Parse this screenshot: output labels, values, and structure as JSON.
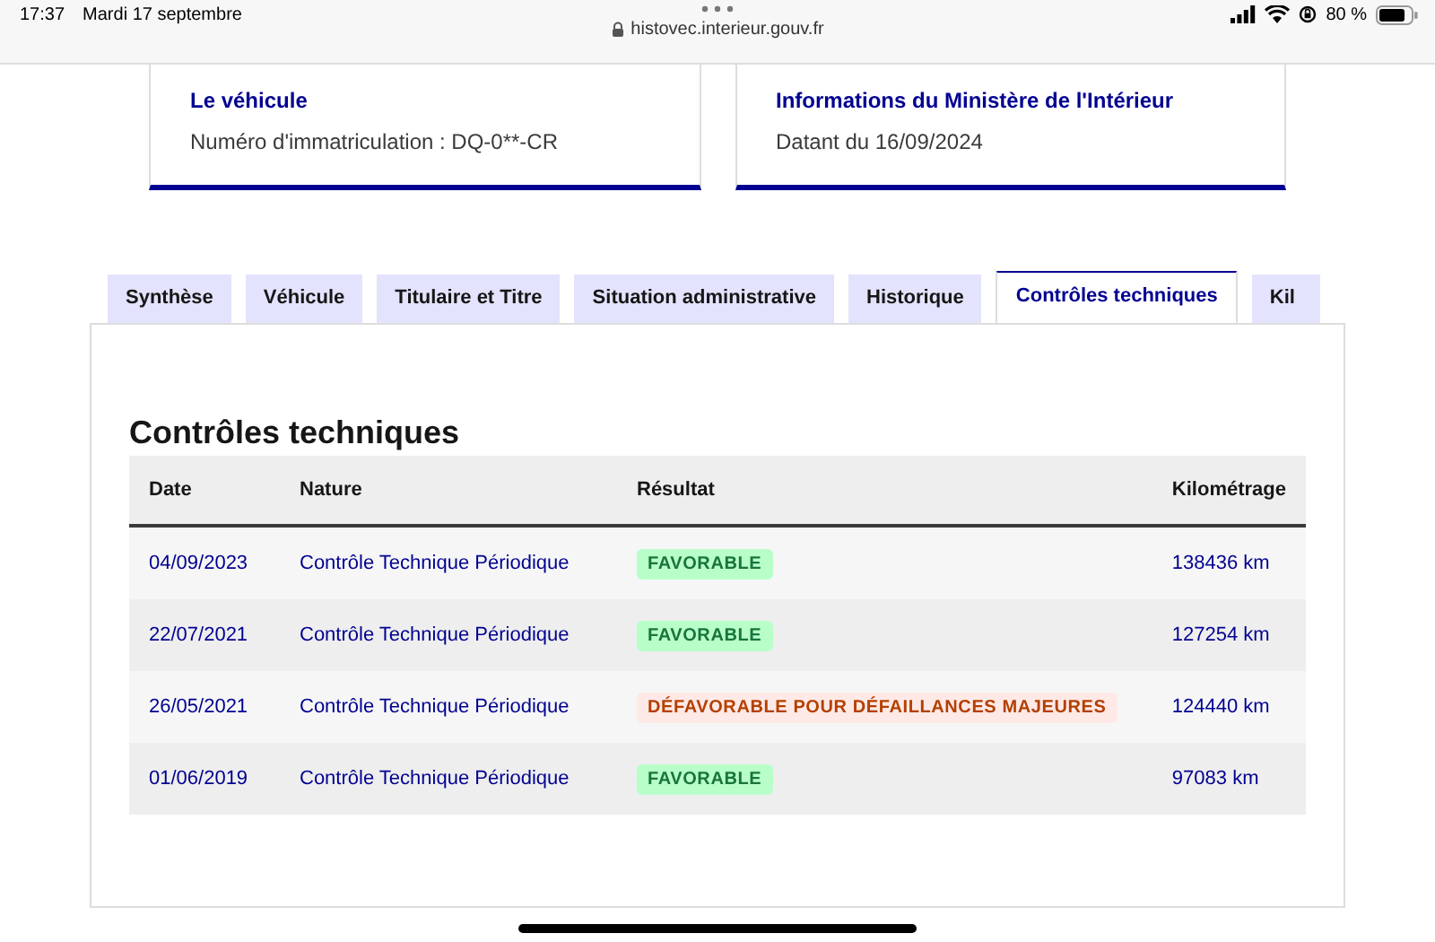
{
  "status_bar": {
    "time": "17:37",
    "date": "Mardi 17 septembre",
    "url": "histovec.interieur.gouv.fr",
    "battery_text": "80 %"
  },
  "cards": [
    {
      "title": "Le véhicule",
      "text": "Numéro d'immatriculation : DQ-0**-CR"
    },
    {
      "title": "Informations du Ministère de l'Intérieur",
      "text": "Datant du 16/09/2024"
    }
  ],
  "tabs": [
    {
      "label": "Synthèse",
      "selected": false
    },
    {
      "label": "Véhicule",
      "selected": false
    },
    {
      "label": "Titulaire et Titre",
      "selected": false
    },
    {
      "label": "Situation administrative",
      "selected": false
    },
    {
      "label": "Historique",
      "selected": false
    },
    {
      "label": "Contrôles techniques",
      "selected": true
    },
    {
      "label": "Kil",
      "selected": false
    }
  ],
  "section_title": "Contrôles techniques",
  "table": {
    "columns": [
      "Date",
      "Nature",
      "Résultat",
      "Kilométrage"
    ],
    "rows": [
      {
        "date": "04/09/2023",
        "nature": "Contrôle Technique Périodique",
        "result": {
          "kind": "favorable",
          "label": "FAVORABLE"
        },
        "mileage": "138436 km"
      },
      {
        "date": "22/07/2021",
        "nature": "Contrôle Technique Périodique",
        "result": {
          "kind": "favorable",
          "label": "FAVORABLE"
        },
        "mileage": "127254 km"
      },
      {
        "date": "26/05/2021",
        "nature": "Contrôle Technique Périodique",
        "result": {
          "kind": "unfavorable",
          "label": "DÉFAVORABLE POUR DÉFAILLANCES MAJEURES"
        },
        "mileage": "124440 km"
      },
      {
        "date": "01/06/2019",
        "nature": "Contrôle Technique Périodique",
        "result": {
          "kind": "favorable",
          "label": "FAVORABLE"
        },
        "mileage": "97083 km"
      }
    ]
  }
}
